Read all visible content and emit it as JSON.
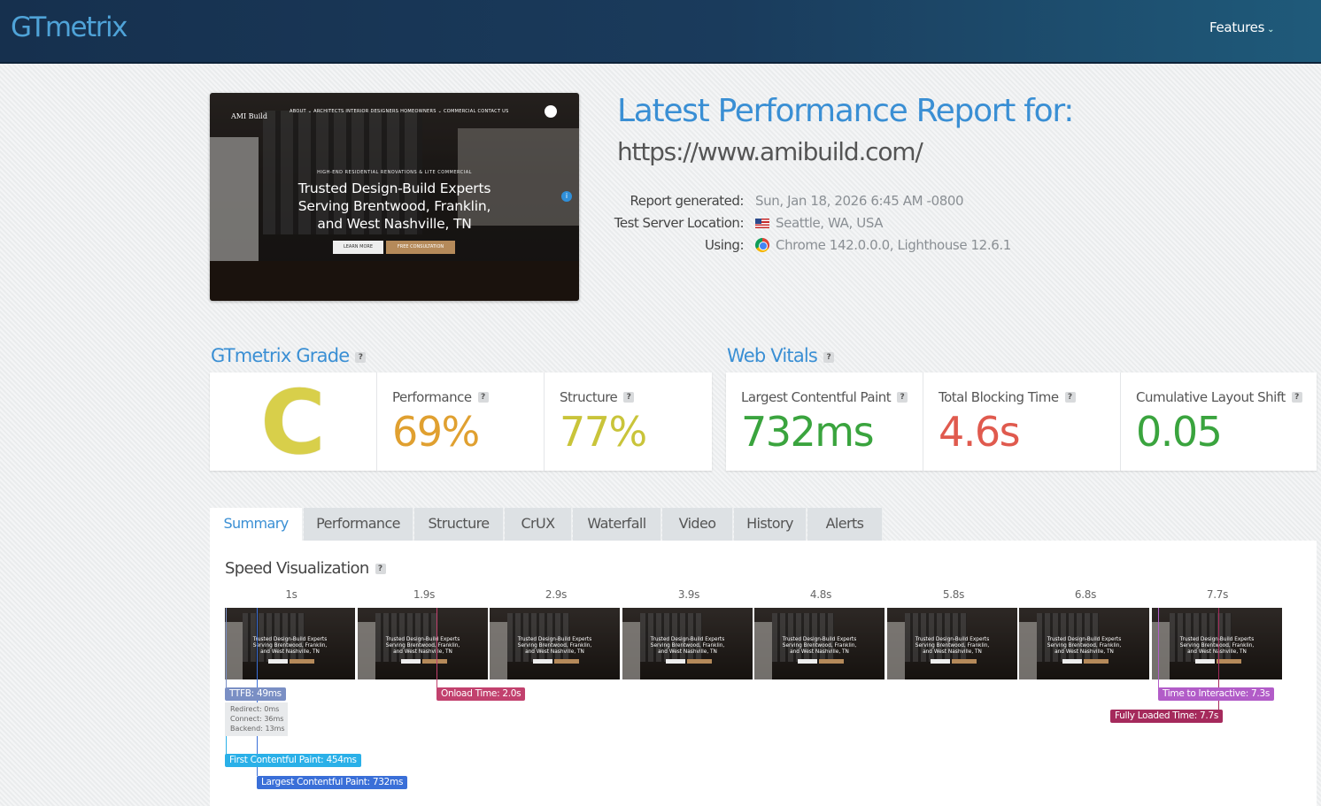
{
  "header": {
    "logo": "GTmetrix",
    "features_label": "Features"
  },
  "thumbnail": {
    "brand": "AMI Build",
    "nav": "ABOUT ⌄   ARCHITECTS   INTERIOR DESIGNERS   HOMEOWNERS ⌄   COMMERCIAL   CONTACT US",
    "small_caps": "HIGH-END RESIDENTIAL RENOVATIONS & LITE COMMERCIAL",
    "hero_line1": "Trusted Design-Build Experts",
    "hero_line2": "Serving Brentwood, Franklin,",
    "hero_line3": "and West Nashville, TN",
    "btn_learn": "LEARN MORE",
    "btn_consult": "FREE CONSULTATION"
  },
  "report": {
    "title": "Latest Performance Report for:",
    "url": "https://www.amibuild.com/",
    "generated_label": "Report generated:",
    "generated_value": "Sun, Jan 18, 2026 6:45 AM -0800",
    "location_label": "Test Server Location:",
    "location_value": "Seattle, WA, USA",
    "using_label": "Using:",
    "using_value": "Chrome 142.0.0.0, Lighthouse 12.6.1"
  },
  "grade": {
    "heading": "GTmetrix Grade",
    "letter": "C",
    "performance_label": "Performance",
    "performance_value": "69%",
    "structure_label": "Structure",
    "structure_value": "77%",
    "letter_color": "#d8cf4a",
    "performance_color": "#e0a030",
    "structure_color": "#c9c43a"
  },
  "vitals": {
    "heading": "Web Vitals",
    "lcp_label": "Largest Contentful Paint",
    "lcp_value": "732ms",
    "tbt_label": "Total Blocking Time",
    "tbt_value": "4.6s",
    "cls_label": "Cumulative Layout Shift",
    "cls_value": "0.05",
    "good_color": "#3aa43e",
    "bad_color": "#e05a4e"
  },
  "tabs": [
    {
      "label": "Summary",
      "active": true
    },
    {
      "label": "Performance",
      "active": false
    },
    {
      "label": "Structure",
      "active": false
    },
    {
      "label": "CrUX",
      "active": false
    },
    {
      "label": "Waterfall",
      "active": false
    },
    {
      "label": "Video",
      "active": false
    },
    {
      "label": "History",
      "active": false
    },
    {
      "label": "Alerts",
      "active": false
    }
  ],
  "speed": {
    "heading": "Speed Visualization",
    "ticks": [
      "1s",
      "1.9s",
      "2.9s",
      "3.9s",
      "4.8s",
      "5.8s",
      "6.8s",
      "7.7s"
    ],
    "frame_text_1": "Trusted Design-Build Experts",
    "frame_text_2": "Serving Brentwood, Franklin,",
    "frame_text_3": "and West Nashville, TN",
    "ttfb": "TTFB: 49ms",
    "ttfb_redirect": "Redirect: 0ms",
    "ttfb_connect": "Connect: 36ms",
    "ttfb_backend": "Backend: 13ms",
    "onload": "Onload Time: 2.0s",
    "fcp": "First Contentful Paint: 454ms",
    "lcp": "Largest Contentful Paint: 732ms",
    "tti": "Time to Interactive: 7.3s",
    "fully_loaded": "Fully Loaded Time: 7.7s"
  }
}
